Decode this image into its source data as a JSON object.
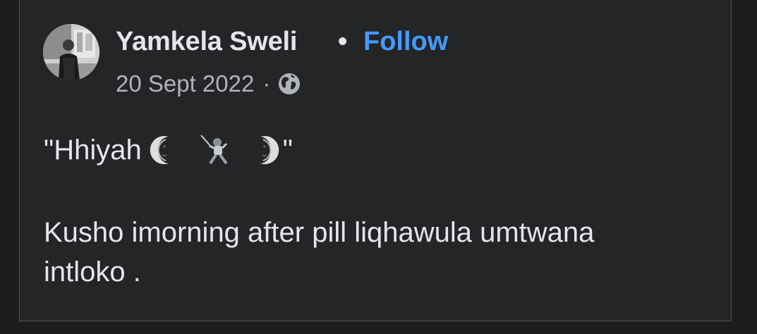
{
  "post": {
    "author": "Yamkela Sweli",
    "separator": "•",
    "follow_label": "Follow",
    "date": "20 Sept 2022",
    "meta_separator": "·",
    "audience_icon": "globe-icon",
    "text": {
      "line1_open": "\"Hhiyah",
      "line1_close": "\"",
      "emojis": [
        "last-quarter-moon-face-icon",
        "fencer-icon",
        "first-quarter-moon-face-icon"
      ],
      "line2": "Kusho imorning after pill liqhawula umtwana",
      "line3": "intloko ."
    }
  },
  "colors": {
    "background": "#1c1d1f",
    "card": "#242527",
    "text": "#e4e6eb",
    "secondary_text": "#b0b3b8",
    "link": "#4599ff"
  }
}
